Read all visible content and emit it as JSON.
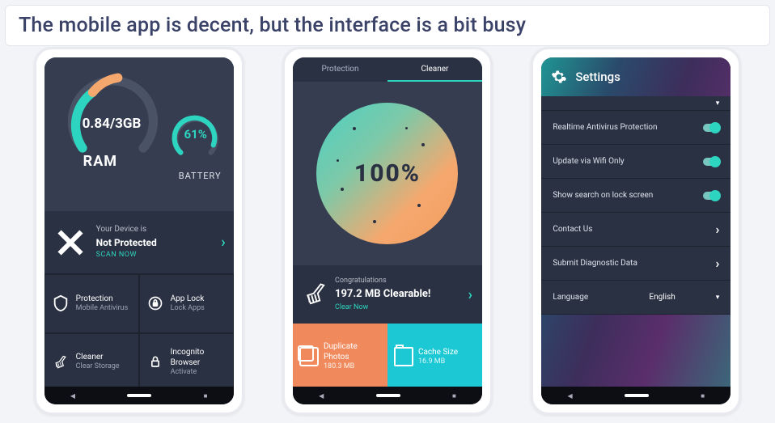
{
  "caption": "The mobile app is decent, but the interface is a bit busy",
  "phone1": {
    "ram_value": "0.84/3GB",
    "ram_label": "RAM",
    "battery_value": "61%",
    "battery_label": "BATTERY",
    "warning": {
      "line1": "Your Device is",
      "line2": "Not Protected",
      "action": "SCAN NOW"
    },
    "tiles": [
      {
        "title": "Protection",
        "subtitle": "Mobile Antivirus",
        "icon": "shield"
      },
      {
        "title": "App Lock",
        "subtitle": "Lock Apps",
        "icon": "lock"
      },
      {
        "title": "Cleaner",
        "subtitle": "Clear Storage",
        "icon": "broom"
      },
      {
        "title": "Incognito Browser",
        "subtitle": "Activate",
        "icon": "incognito"
      }
    ]
  },
  "phone2": {
    "tabs": [
      "Protection",
      "Cleaner"
    ],
    "active_tab": "Cleaner",
    "progress": "100%",
    "clear": {
      "line1": "Congratulations",
      "line2": "197.2 MB Clearable!",
      "action": "Clear Now"
    },
    "cards": [
      {
        "title": "Duplicate Photos",
        "subtitle": "180.3 MB"
      },
      {
        "title": "Cache Size",
        "subtitle": "16.9 MB"
      }
    ]
  },
  "phone3": {
    "header": "Settings",
    "rows": [
      {
        "label": "Realtime Antivirus Protection",
        "type": "toggle"
      },
      {
        "label": "Update via Wifi Only",
        "type": "toggle"
      },
      {
        "label": "Show search on lock screen",
        "type": "toggle"
      },
      {
        "label": "Contact Us",
        "type": "nav"
      },
      {
        "label": "Submit Diagnostic Data",
        "type": "nav"
      },
      {
        "label": "Language",
        "type": "select",
        "value": "English"
      }
    ]
  }
}
